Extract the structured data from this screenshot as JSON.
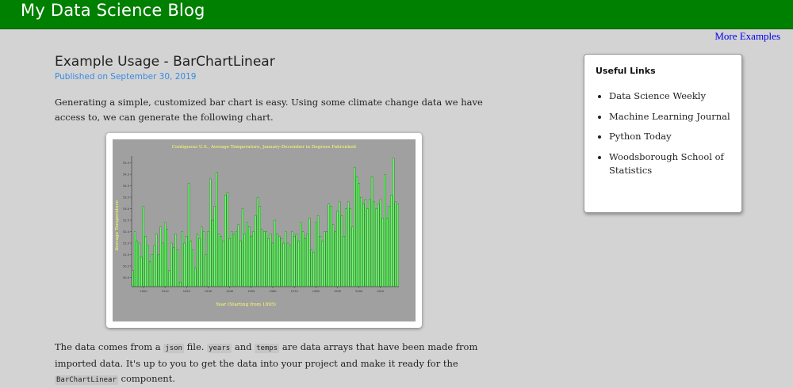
{
  "header": {
    "site_title": "My Data Science Blog",
    "more_examples": "More Examples",
    "bar_color": "#008000"
  },
  "post": {
    "title": "Example Usage - BarChartLinear",
    "date": "Published on September 30, 2019",
    "intro": "Generating a simple, customized bar chart is easy. Using some climate change data we have access to, we can generate the following chart.",
    "body": {
      "t1": "The data comes from a ",
      "c1": "json",
      "t2": " file. ",
      "c2": "years",
      "t3": " and ",
      "c3": "temps",
      "t4": " are data arrays that have been made from imported data. It's up to you to get the data into your project and make it ready for the ",
      "c4": "BarChartLinear",
      "t5": " component."
    }
  },
  "sidebar": {
    "heading": "Useful Links",
    "links": [
      {
        "label": "Data Science Weekly"
      },
      {
        "label": "Machine Learning Journal"
      },
      {
        "label": "Python Today"
      },
      {
        "label": "Woodsborough School of Statistics"
      }
    ]
  },
  "chart_data": {
    "type": "bar",
    "title": "Contiguous U.S., Average Temperature, January-December in Degrees Fahrenheit",
    "xlabel": "Year (Starting from 1895)",
    "ylabel": "Average Temperature",
    "x_ticks": [
      1900,
      1910,
      1920,
      1930,
      1940,
      1950,
      1960,
      1970,
      1980,
      1990,
      2000,
      2010
    ],
    "y_ticks": [
      "50.0",
      "50.5",
      "51.0",
      "51.5",
      "52.0",
      "52.5",
      "53.0",
      "53.5",
      "54.0",
      "54.5",
      "55.0"
    ],
    "ylim": [
      49.6,
      55.3
    ],
    "x_start": 1895,
    "plot_background": "#a0a0a0",
    "bar_color": "#66ff66",
    "text_color": "#ffff66",
    "categories": [
      1895,
      1896,
      1897,
      1898,
      1899,
      1900,
      1901,
      1902,
      1903,
      1904,
      1905,
      1906,
      1907,
      1908,
      1909,
      1910,
      1911,
      1912,
      1913,
      1914,
      1915,
      1916,
      1917,
      1918,
      1919,
      1920,
      1921,
      1922,
      1923,
      1924,
      1925,
      1926,
      1927,
      1928,
      1929,
      1930,
      1931,
      1932,
      1933,
      1934,
      1935,
      1936,
      1937,
      1938,
      1939,
      1940,
      1941,
      1942,
      1943,
      1944,
      1945,
      1946,
      1947,
      1948,
      1949,
      1950,
      1951,
      1952,
      1953,
      1954,
      1955,
      1956,
      1957,
      1958,
      1959,
      1960,
      1961,
      1962,
      1963,
      1964,
      1965,
      1966,
      1967,
      1968,
      1969,
      1970,
      1971,
      1972,
      1973,
      1974,
      1975,
      1976,
      1977,
      1978,
      1979,
      1980,
      1981,
      1982,
      1983,
      1984,
      1985,
      1986,
      1987,
      1988,
      1989,
      1990,
      1991,
      1992,
      1993,
      1994,
      1995,
      1996,
      1997,
      1998,
      1999,
      2000,
      2001,
      2002,
      2003,
      2004,
      2005,
      2006,
      2007,
      2008,
      2009,
      2010,
      2011,
      2012,
      2013,
      2014,
      2015,
      2016,
      2017,
      2018
    ],
    "values": [
      50.3,
      52.0,
      51.6,
      51.5,
      50.9,
      53.1,
      51.8,
      51.4,
      50.7,
      51.0,
      51.4,
      51.9,
      51.0,
      52.2,
      51.5,
      52.4,
      52.1,
      50.3,
      51.5,
      51.3,
      51.9,
      51.2,
      49.8,
      52.0,
      51.5,
      51.8,
      54.1,
      51.6,
      51.2,
      50.4,
      51.9,
      51.7,
      52.2,
      52.0,
      51.0,
      52.0,
      54.3,
      52.5,
      53.1,
      54.6,
      51.9,
      51.8,
      51.6,
      53.6,
      53.7,
      51.7,
      52.0,
      51.9,
      52.0,
      52.3,
      51.6,
      53.0,
      51.9,
      52.4,
      52.2,
      51.8,
      52.0,
      52.7,
      53.5,
      53.1,
      52.1,
      52.0,
      52.0,
      51.7,
      51.9,
      51.5,
      52.5,
      51.9,
      51.8,
      51.7,
      51.5,
      52.0,
      51.5,
      51.4,
      52.0,
      51.8,
      51.9,
      51.6,
      52.4,
      52.0,
      51.7,
      51.9,
      52.6,
      51.2,
      51.1,
      52.4,
      52.7,
      51.8,
      51.6,
      52.0,
      52.0,
      53.2,
      53.1,
      52.3,
      52.0,
      52.9,
      53.3,
      52.7,
      51.8,
      53.0,
      53.3,
      53.0,
      52.2,
      54.8,
      54.4,
      54.1,
      53.5,
      53.2,
      53.4,
      53.0,
      53.4,
      54.4,
      53.3,
      53.0,
      53.2,
      53.4,
      52.6,
      54.5,
      52.6,
      53.1,
      53.6,
      55.2,
      53.3,
      53.2
    ]
  }
}
